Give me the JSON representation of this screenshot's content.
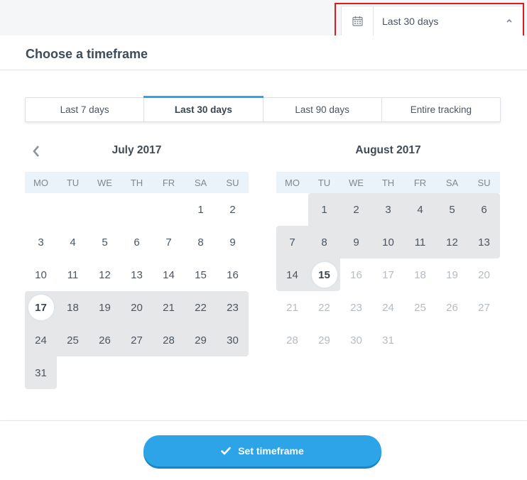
{
  "picker": {
    "selected_label": "Last 30 days",
    "calendar_icon": "calendar-icon",
    "chevron_icon": "chevron-up-icon"
  },
  "panel": {
    "title": "Choose a timeframe"
  },
  "tabs": [
    {
      "label": "Last 7 days",
      "active": false
    },
    {
      "label": "Last 30 days",
      "active": true
    },
    {
      "label": "Last 90 days",
      "active": false
    },
    {
      "label": "Entire tracking",
      "active": false
    }
  ],
  "calendars": {
    "prev_icon": "chevron-left-icon",
    "weekdays": [
      "MO",
      "TU",
      "WE",
      "TH",
      "FR",
      "SA",
      "SU"
    ],
    "left": {
      "title": "July 2017",
      "weeks": [
        [
          "",
          "",
          "",
          "",
          "",
          "1",
          "2"
        ],
        [
          "3",
          "4",
          "5",
          "6",
          "7",
          "8",
          "9"
        ],
        [
          "10",
          "11",
          "12",
          "13",
          "14",
          "15",
          "16"
        ],
        [
          "17",
          "18",
          "19",
          "20",
          "21",
          "22",
          "23"
        ],
        [
          "24",
          "25",
          "26",
          "27",
          "28",
          "29",
          "30"
        ],
        [
          "31",
          "",
          "",
          "",
          "",
          "",
          ""
        ]
      ]
    },
    "right": {
      "title": "August 2017",
      "weeks": [
        [
          "",
          "1",
          "2",
          "3",
          "4",
          "5",
          "6"
        ],
        [
          "7",
          "8",
          "9",
          "10",
          "11",
          "12",
          "13"
        ],
        [
          "14",
          "15",
          "16",
          "17",
          "18",
          "19",
          "20"
        ],
        [
          "21",
          "22",
          "23",
          "24",
          "25",
          "26",
          "27"
        ],
        [
          "28",
          "29",
          "30",
          "31",
          "",
          "",
          ""
        ]
      ]
    },
    "range_start": "17",
    "today": "15"
  },
  "footer": {
    "button_label": "Set timeframe",
    "button_icon": "checkmark-icon"
  },
  "colors": {
    "accent": "#2ea4e8",
    "highlight_border": "#e0191b",
    "range_fill": "#e6e7e8",
    "weekday_header": "#eaf3fa"
  }
}
